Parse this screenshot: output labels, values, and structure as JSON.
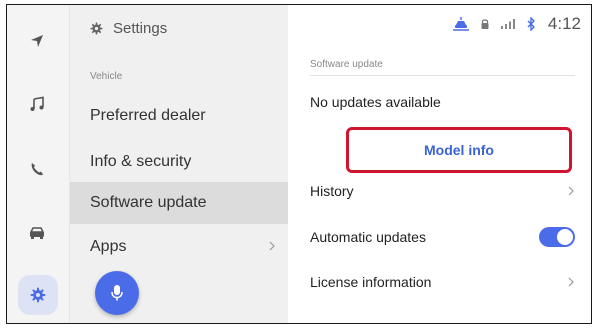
{
  "settings_header": {
    "label": "Settings",
    "icon": "gear-icon"
  },
  "left_rail": {
    "items": [
      {
        "name": "navigation",
        "icon": "navigation-arrow-icon"
      },
      {
        "name": "music",
        "icon": "music-note-icon"
      },
      {
        "name": "phone",
        "icon": "phone-icon"
      },
      {
        "name": "vehicle",
        "icon": "car-icon"
      },
      {
        "name": "settings",
        "icon": "gear-icon",
        "active": true
      }
    ]
  },
  "menu": {
    "section_label": "Vehicle",
    "items": [
      {
        "label": "Preferred dealer"
      },
      {
        "label": "Info & security"
      },
      {
        "label": "Software update",
        "active": true
      },
      {
        "label": "Apps",
        "has_chevron": true
      }
    ]
  },
  "mic": {
    "icon": "microphone-icon",
    "color": "#4b6ce8"
  },
  "status_bar": {
    "time": "4:12",
    "icons": [
      "car-connection-icon",
      "lock-icon",
      "signal-bars-icon",
      "bluetooth-icon"
    ]
  },
  "panel": {
    "section_label": "Software update",
    "status_text": "No updates available",
    "model_info_label": "Model info",
    "rows": [
      {
        "label": "History",
        "has_chevron": true
      },
      {
        "label": "Automatic updates",
        "toggle_on": true
      },
      {
        "label": "License information",
        "has_chevron": true
      }
    ]
  },
  "colors": {
    "accent": "#4b6ce8",
    "highlight_border": "#d0152f",
    "link_text": "#3b63d8"
  }
}
